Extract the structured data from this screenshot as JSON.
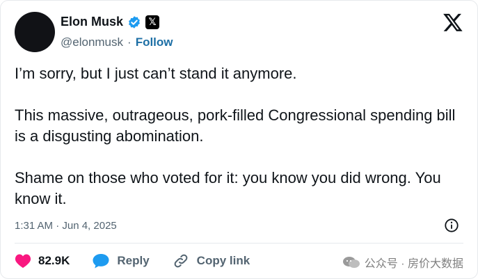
{
  "user": {
    "name": "Elon Musk",
    "handle": "@elonmusk",
    "separator": "·",
    "follow_label": "Follow"
  },
  "tweet": {
    "text": "I’m sorry, but I just can’t stand it anymore.\n\nThis massive, outrageous, pork-filled Congressional spending bill is a disgusting abomination.\n\nShame on those who voted for it: you know you did wrong. You know it.",
    "timestamp": "1:31 AM · Jun 4, 2025"
  },
  "actions": {
    "likes": "82.9K",
    "reply_label": "Reply",
    "copy_link_label": "Copy link"
  },
  "watermark": {
    "text": "公众号 · 房价大数据"
  },
  "colors": {
    "accent": "#1d9bf0",
    "like": "#f91880",
    "text": "#0f1419",
    "muted": "#536471"
  },
  "icons": {
    "verified": "verified-badge-icon",
    "x_badge": "x-badge-icon",
    "x_logo": "x-logo-icon",
    "info": "info-icon",
    "heart": "heart-icon",
    "reply": "reply-icon",
    "link": "link-icon",
    "wechat": "wechat-icon"
  }
}
